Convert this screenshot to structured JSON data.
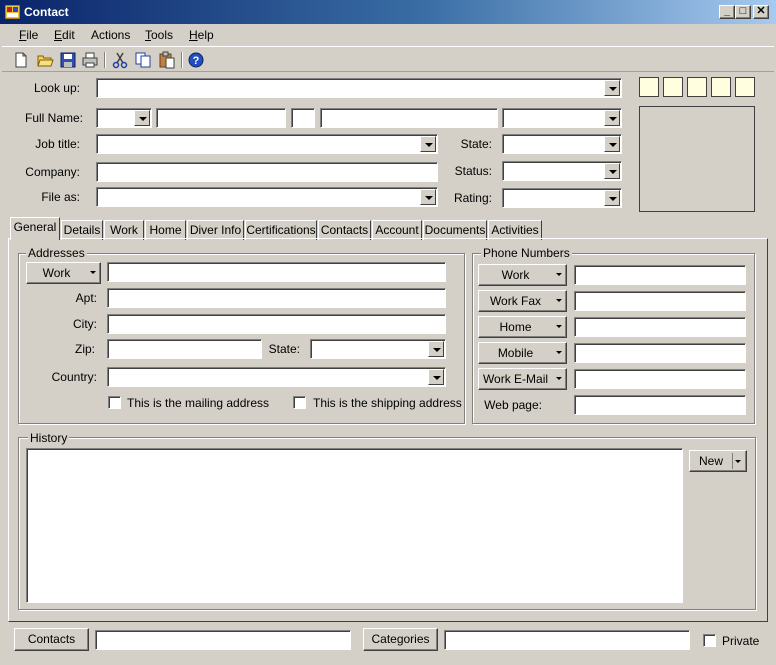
{
  "window": {
    "title": "Contact",
    "controls": {
      "minimize": "_",
      "maximize": "□",
      "close": "✕"
    }
  },
  "menu": [
    {
      "label": "File",
      "u": "F",
      "rest": "ile"
    },
    {
      "label": "Edit",
      "u": "E",
      "rest": "dit"
    },
    {
      "label": "Actions",
      "u": "",
      "rest": "Actions"
    },
    {
      "label": "Tools",
      "u": "T",
      "rest": "ools"
    },
    {
      "label": "Help",
      "u": "H",
      "rest": "elp"
    }
  ],
  "toolbar_icons": [
    "new-icon",
    "open-icon",
    "save-icon",
    "print-icon",
    "cut-icon",
    "copy-icon",
    "paste-icon",
    "help-icon"
  ],
  "header": {
    "lookup_label": "Look up:",
    "fullname_label": "Full Name:",
    "jobtitle_label": "Job title:",
    "company_label": "Company:",
    "fileas_label": "File as:",
    "state_label": "State:",
    "status_label": "Status:",
    "rating_label": "Rating:"
  },
  "tabs": [
    "General",
    "Details",
    "Work",
    "Home",
    "Diver Info",
    "Certifications",
    "Contacts",
    "Account",
    "Documents",
    "Activities"
  ],
  "addresses": {
    "title": "Addresses",
    "type_button": "Work",
    "apt_label": "Apt:",
    "city_label": "City:",
    "zip_label": "Zip:",
    "state_label": "State:",
    "country_label": "Country:",
    "mailing_label": "This is the mailing address",
    "shipping_label": "This is the shipping address"
  },
  "phones": {
    "title": "Phone Numbers",
    "buttons": [
      "Work",
      "Work Fax",
      "Home",
      "Mobile",
      "Work E-Mail"
    ],
    "webpage_label": "Web page:"
  },
  "history": {
    "title": "History",
    "new_button": "New"
  },
  "footer": {
    "contacts_button": "Contacts",
    "categories_button": "Categories",
    "private_label": "Private"
  },
  "colors": {
    "window_bg": "#d4d0c8",
    "title_start": "#0a246a",
    "title_end": "#a6caf0",
    "swatch": "#ffffe0"
  }
}
